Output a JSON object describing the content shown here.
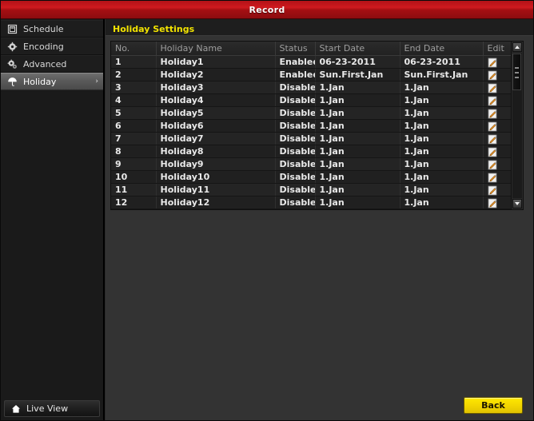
{
  "window": {
    "title": "Record"
  },
  "sidebar": {
    "items": [
      {
        "label": "Schedule",
        "icon": "calendar-icon",
        "selected": false,
        "chevron": ""
      },
      {
        "label": "Encoding",
        "icon": "gear-icon",
        "selected": false,
        "chevron": ""
      },
      {
        "label": "Advanced",
        "icon": "gears-icon",
        "selected": false,
        "chevron": ""
      },
      {
        "label": "Holiday",
        "icon": "umbrella-icon",
        "selected": true,
        "chevron": "›"
      }
    ],
    "live_view": {
      "label": "Live View",
      "icon": "home-icon"
    }
  },
  "main": {
    "tab_label": "Holiday Settings",
    "table": {
      "columns": [
        "No.",
        "Holiday Name",
        "Status",
        "Start Date",
        "End Date",
        "Edit"
      ],
      "rows": [
        {
          "no": "1",
          "name": "Holiday1",
          "status": "Enabled",
          "start": "06-23-2011",
          "end": "06-23-2011",
          "edit_icon": "edit-pencil-icon"
        },
        {
          "no": "2",
          "name": "Holiday2",
          "status": "Enabled",
          "start": "Sun.First.Jan",
          "end": "Sun.First.Jan",
          "edit_icon": "edit-pencil-icon"
        },
        {
          "no": "3",
          "name": "Holiday3",
          "status": "Disabled",
          "start": "1.Jan",
          "end": "1.Jan",
          "edit_icon": "edit-pencil-icon"
        },
        {
          "no": "4",
          "name": "Holiday4",
          "status": "Disabled",
          "start": "1.Jan",
          "end": "1.Jan",
          "edit_icon": "edit-pencil-icon"
        },
        {
          "no": "5",
          "name": "Holiday5",
          "status": "Disabled",
          "start": "1.Jan",
          "end": "1.Jan",
          "edit_icon": "edit-pencil-icon"
        },
        {
          "no": "6",
          "name": "Holiday6",
          "status": "Disabled",
          "start": "1.Jan",
          "end": "1.Jan",
          "edit_icon": "edit-pencil-icon"
        },
        {
          "no": "7",
          "name": "Holiday7",
          "status": "Disabled",
          "start": "1.Jan",
          "end": "1.Jan",
          "edit_icon": "edit-pencil-icon"
        },
        {
          "no": "8",
          "name": "Holiday8",
          "status": "Disabled",
          "start": "1.Jan",
          "end": "1.Jan",
          "edit_icon": "edit-pencil-icon"
        },
        {
          "no": "9",
          "name": "Holiday9",
          "status": "Disabled",
          "start": "1.Jan",
          "end": "1.Jan",
          "edit_icon": "edit-pencil-icon"
        },
        {
          "no": "10",
          "name": "Holiday10",
          "status": "Disabled",
          "start": "1.Jan",
          "end": "1.Jan",
          "edit_icon": "edit-pencil-icon"
        },
        {
          "no": "11",
          "name": "Holiday11",
          "status": "Disabled",
          "start": "1.Jan",
          "end": "1.Jan",
          "edit_icon": "edit-pencil-icon"
        },
        {
          "no": "12",
          "name": "Holiday12",
          "status": "Disabled",
          "start": "1.Jan",
          "end": "1.Jan",
          "edit_icon": "edit-pencil-icon"
        }
      ]
    },
    "scrollbar": {
      "up_icon": "scroll-up-arrow-icon",
      "down_icon": "scroll-down-arrow-icon"
    }
  },
  "footer": {
    "back_label": "Back"
  },
  "colors": {
    "titlebar_red": "#cf1a1f",
    "accent_yellow": "#f2e300",
    "back_button_yellow": "#f3d600",
    "panel_bg": "#333333",
    "sidebar_bg": "#1a1a1a"
  }
}
